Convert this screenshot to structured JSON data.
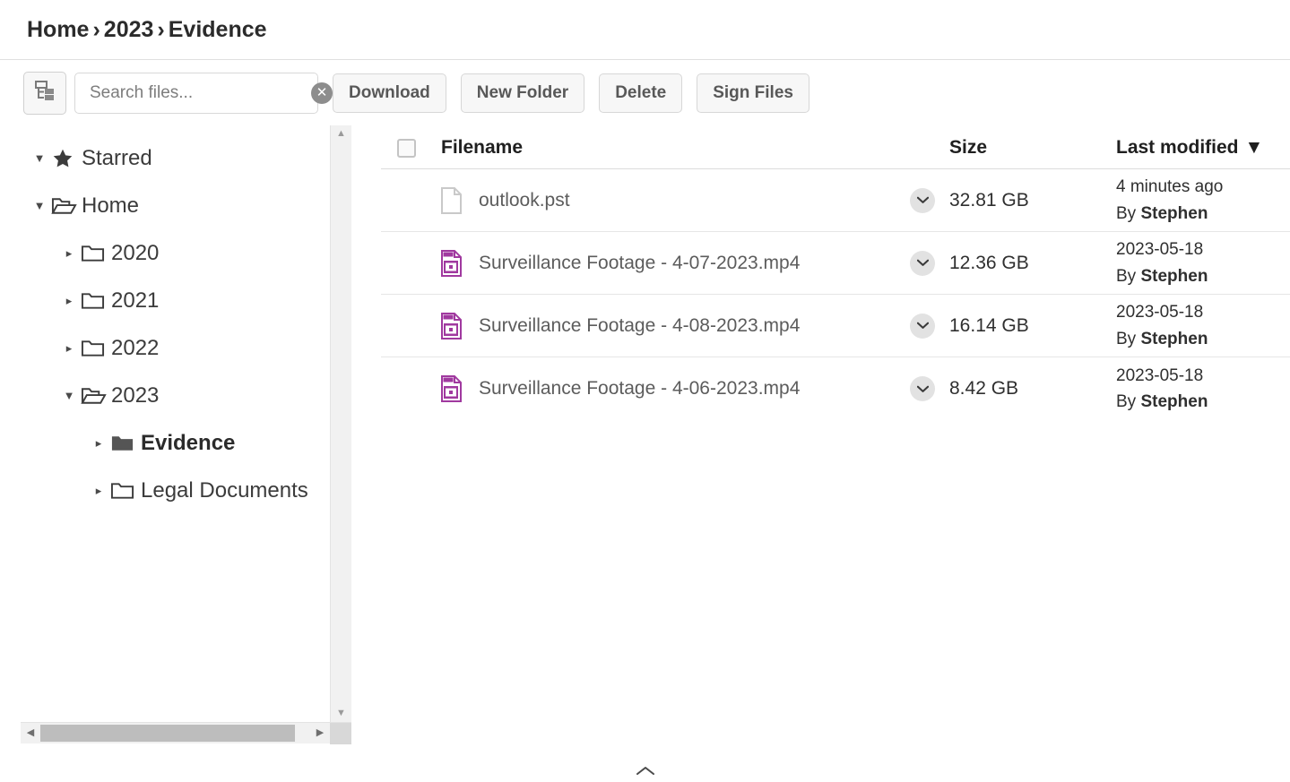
{
  "breadcrumb": {
    "items": [
      "Home",
      "2023",
      "Evidence"
    ],
    "separator": "›"
  },
  "toolbar": {
    "tree_toggle_icon": "tree-view-icon",
    "search": {
      "value": "",
      "placeholder": "Search files...",
      "clear_icon": "✕"
    },
    "buttons": [
      {
        "label": "Download",
        "name": "download-button"
      },
      {
        "label": "New Folder",
        "name": "new-folder-button"
      },
      {
        "label": "Delete",
        "name": "delete-button"
      },
      {
        "label": "Sign Files",
        "name": "sign-files-button"
      }
    ]
  },
  "sidebar": {
    "caret_expanded": "▼",
    "caret_collapsed": "▸",
    "nodes": [
      {
        "label": "Starred",
        "icon": "star-icon",
        "indent": 0,
        "expanded": true,
        "selected": false
      },
      {
        "label": "Home",
        "icon": "folder-open-icon",
        "indent": 0,
        "expanded": true,
        "selected": false
      },
      {
        "label": "2020",
        "icon": "folder-icon",
        "indent": 1,
        "expanded": false,
        "selected": false
      },
      {
        "label": "2021",
        "icon": "folder-icon",
        "indent": 1,
        "expanded": false,
        "selected": false
      },
      {
        "label": "2022",
        "icon": "folder-icon",
        "indent": 1,
        "expanded": false,
        "selected": false
      },
      {
        "label": "2023",
        "icon": "folder-open-icon",
        "indent": 1,
        "expanded": true,
        "selected": false
      },
      {
        "label": "Evidence",
        "icon": "folder-filled-icon",
        "indent": 2,
        "expanded": false,
        "selected": true
      },
      {
        "label": "Legal Documents",
        "icon": "folder-icon",
        "indent": 2,
        "expanded": false,
        "selected": false
      }
    ],
    "scrollbar": {
      "up_arrow": "▲",
      "down_arrow": "▼",
      "left_arrow": "◀",
      "right_arrow": "▶"
    }
  },
  "filelist": {
    "headers": {
      "filename": "Filename",
      "size": "Size",
      "last_modified": "Last modified",
      "sort_indicator": "▼"
    },
    "row_caret": "❯",
    "by_prefix": "By",
    "rows": [
      {
        "filename": "outlook.pst",
        "icon": "document-file-icon",
        "size": "32.81 GB",
        "modified": "4 minutes ago",
        "author": "Stephen"
      },
      {
        "filename": "Surveillance Footage - 4-07-2023.mp4",
        "icon": "mp4-video-file-icon",
        "size": "12.36 GB",
        "modified": "2023-05-18",
        "author": "Stephen"
      },
      {
        "filename": "Surveillance Footage - 4-08-2023.mp4",
        "icon": "mp4-video-file-icon",
        "size": "16.14 GB",
        "modified": "2023-05-18",
        "author": "Stephen"
      },
      {
        "filename": "Surveillance Footage - 4-06-2023.mp4",
        "icon": "mp4-video-file-icon",
        "size": "8.42 GB",
        "modified": "2023-05-18",
        "author": "Stephen"
      }
    ]
  },
  "footer": {
    "collapse_icon": "⌃"
  },
  "colors": {
    "video_icon": "#a0399f",
    "video_icon_light": "#d9a8d8",
    "text_primary": "#2b2b2b",
    "text_secondary": "#5c5c5c",
    "border": "#e0e0e0",
    "button_bg": "#f7f7f7"
  }
}
